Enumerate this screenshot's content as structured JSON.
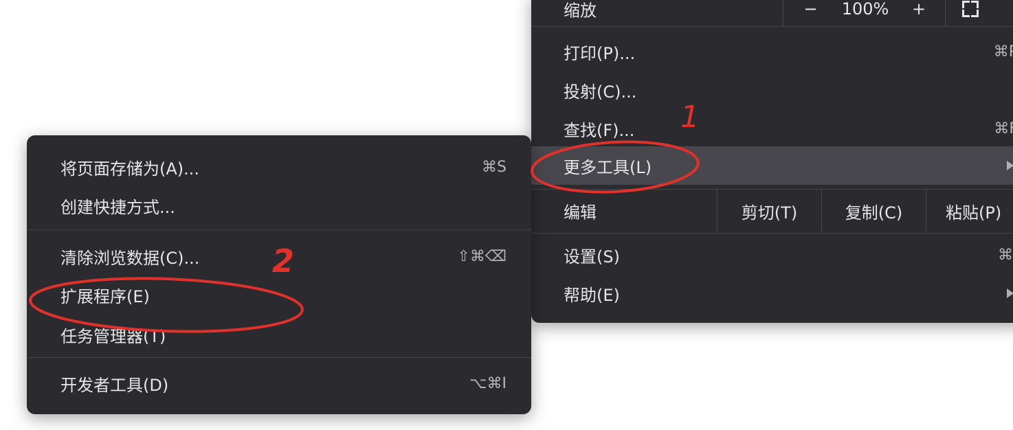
{
  "main_menu": {
    "zoom": {
      "label": "缩放",
      "minus": "−",
      "value": "100%",
      "plus": "+"
    },
    "items": [
      {
        "label": "打印(P)...",
        "shortcut": "⌘P"
      },
      {
        "label": "投射(C)...",
        "shortcut": ""
      },
      {
        "label": "查找(F)...",
        "shortcut": "⌘F"
      },
      {
        "label": "更多工具(L)",
        "shortcut": ""
      }
    ],
    "edit": {
      "label": "编辑",
      "cut": "剪切(T)",
      "copy": "复制(C)",
      "paste": "粘贴(P)"
    },
    "bottom_items": [
      {
        "label": "设置(S)",
        "shortcut": "⌘,"
      },
      {
        "label": "帮助(E)",
        "shortcut": ""
      }
    ]
  },
  "sub_menu": {
    "items": [
      {
        "label": "将页面存储为(A)...",
        "shortcut": "⌘S"
      },
      {
        "label": "创建快捷方式...",
        "shortcut": ""
      },
      {
        "label": "清除浏览数据(C)...",
        "shortcut": "⇧⌘⌫"
      },
      {
        "label": "扩展程序(E)",
        "shortcut": ""
      },
      {
        "label": "任务管理器(T)",
        "shortcut": ""
      },
      {
        "label": "开发者工具(D)",
        "shortcut": "⌥⌘I"
      }
    ]
  },
  "annotations": {
    "step1": "1",
    "step2": "2",
    "color": "#e0322b"
  },
  "colors": {
    "menu_bg": "#2a2a2f",
    "highlight": "#47474d",
    "text": "#e6e6e8"
  }
}
